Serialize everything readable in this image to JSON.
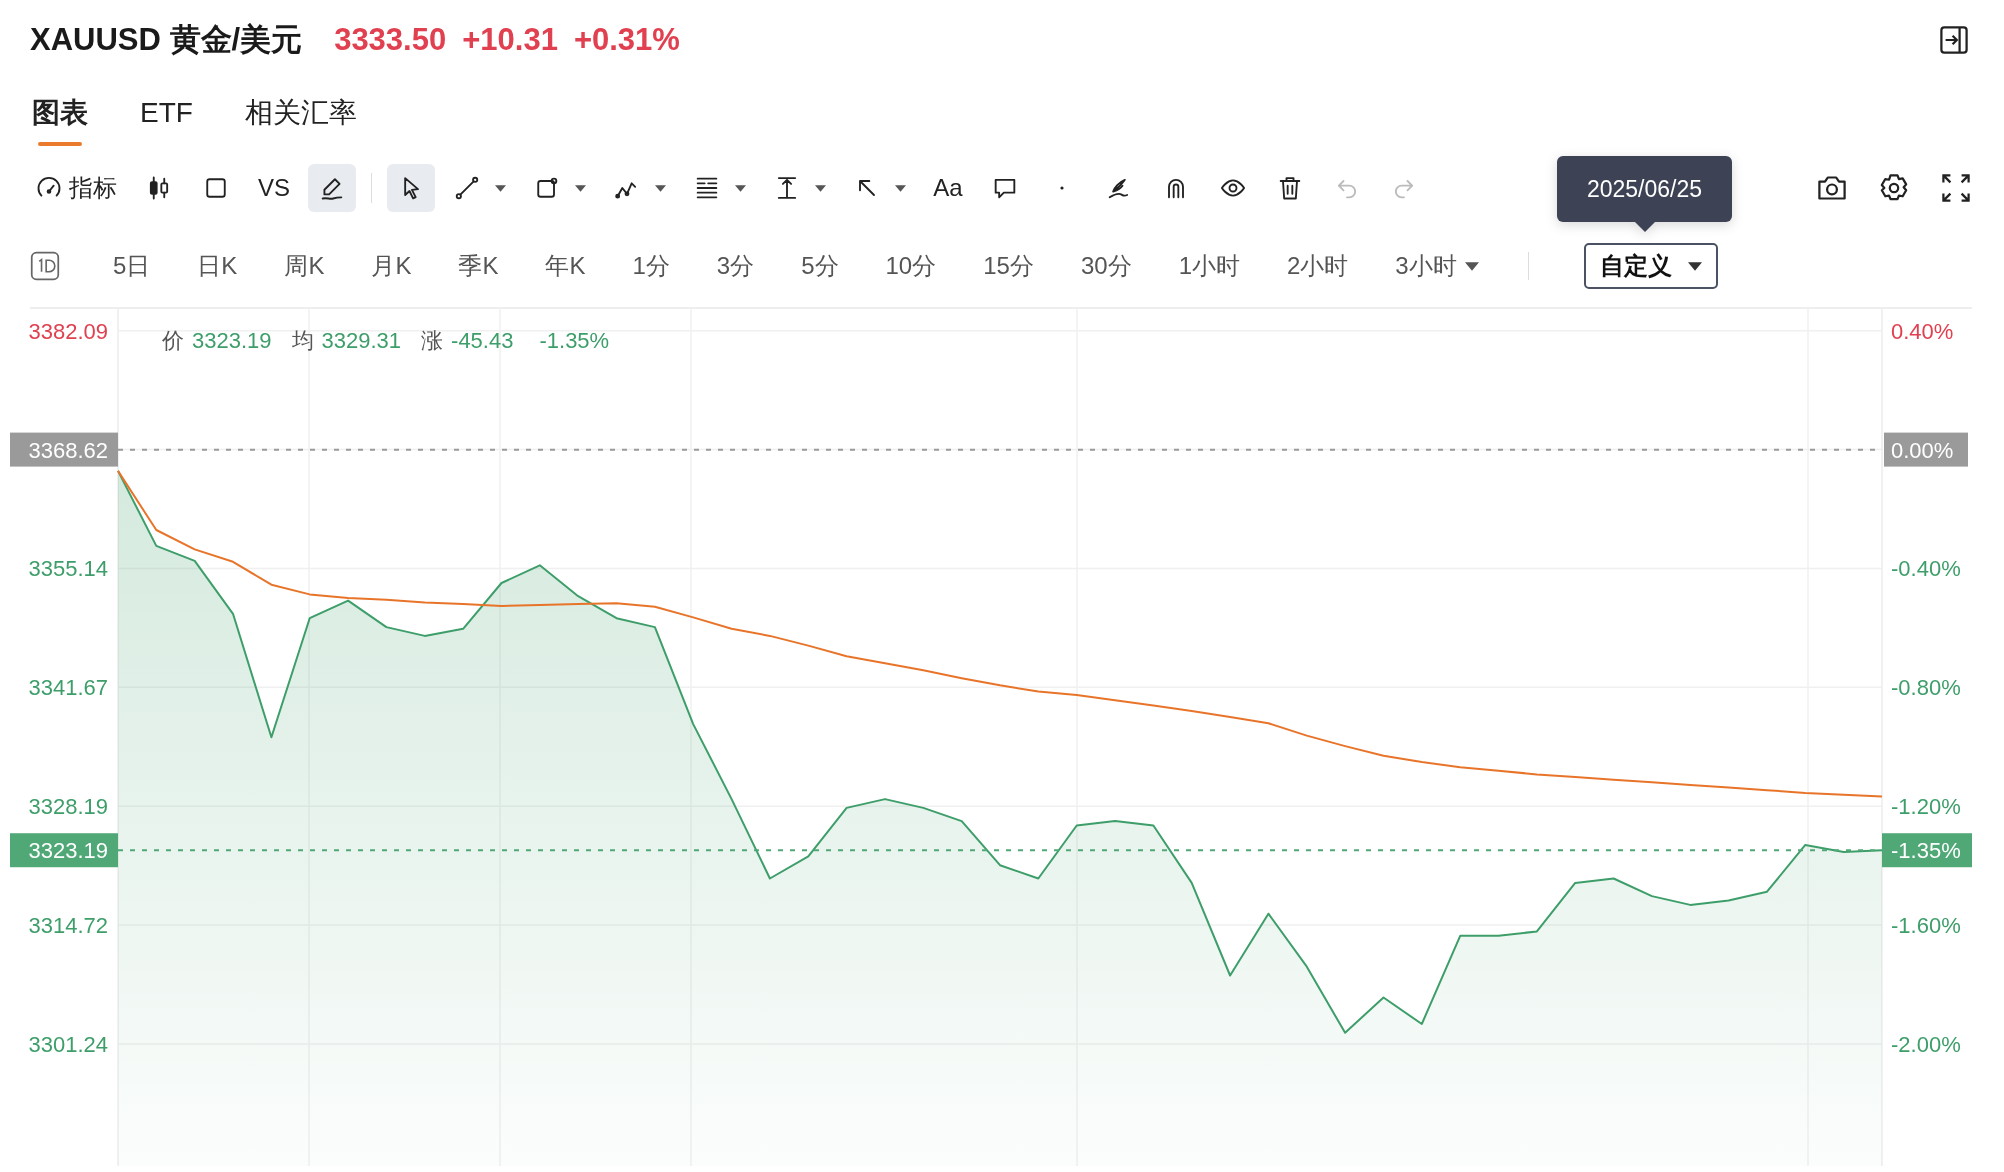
{
  "header": {
    "symbol": "XAUUSD 黄金/美元",
    "price": "3333.50",
    "change": "+10.31",
    "change_percent": "+0.31%"
  },
  "tabs": [
    {
      "label": "图表",
      "selected": true
    },
    {
      "label": "ETF",
      "selected": false
    },
    {
      "label": "相关汇率",
      "selected": false
    }
  ],
  "toolbar": {
    "tools": [
      {
        "kind": "icon-text",
        "label": "指标",
        "selected": false,
        "dropdown": false,
        "disabled": false
      },
      {
        "kind": "icon",
        "selected": false,
        "dropdown": false,
        "disabled": false
      },
      {
        "kind": "icon",
        "selected": false,
        "dropdown": false,
        "disabled": false
      },
      {
        "kind": "text",
        "label": "VS",
        "selected": false,
        "dropdown": false,
        "disabled": false
      },
      {
        "kind": "icon",
        "selected": true,
        "dropdown": false,
        "disabled": false
      },
      {
        "kind": "divider"
      },
      {
        "kind": "icon",
        "selected": true,
        "dropdown": false,
        "disabled": false
      },
      {
        "kind": "icon",
        "selected": false,
        "dropdown": true,
        "disabled": false
      },
      {
        "kind": "icon",
        "selected": false,
        "dropdown": true,
        "disabled": false
      },
      {
        "kind": "icon",
        "selected": false,
        "dropdown": true,
        "disabled": false
      },
      {
        "kind": "icon",
        "selected": false,
        "dropdown": true,
        "disabled": false
      },
      {
        "kind": "icon",
        "selected": false,
        "dropdown": true,
        "disabled": false
      },
      {
        "kind": "icon",
        "selected": false,
        "dropdown": true,
        "disabled": false
      },
      {
        "kind": "text",
        "label": "Aa",
        "selected": false,
        "dropdown": false,
        "disabled": false
      },
      {
        "kind": "icon",
        "selected": false,
        "dropdown": false,
        "disabled": false
      },
      {
        "kind": "icon",
        "selected": false,
        "dropdown": false,
        "disabled": false
      },
      {
        "kind": "icon",
        "selected": false,
        "dropdown": false,
        "disabled": false
      },
      {
        "kind": "icon",
        "selected": false,
        "dropdown": false,
        "disabled": false
      },
      {
        "kind": "icon",
        "selected": false,
        "dropdown": false,
        "disabled": false
      },
      {
        "kind": "icon",
        "selected": false,
        "dropdown": false,
        "disabled": false
      },
      {
        "kind": "icon",
        "selected": false,
        "dropdown": false,
        "disabled": true
      },
      {
        "kind": "icon",
        "selected": false,
        "dropdown": false,
        "disabled": true
      }
    ]
  },
  "intervals": [
    {
      "label": "5日",
      "selected": false,
      "dropdown": false
    },
    {
      "label": "日K",
      "selected": false,
      "dropdown": false
    },
    {
      "label": "周K",
      "selected": false,
      "dropdown": false
    },
    {
      "label": "月K",
      "selected": false,
      "dropdown": false
    },
    {
      "label": "季K",
      "selected": false,
      "dropdown": false
    },
    {
      "label": "年K",
      "selected": false,
      "dropdown": false
    },
    {
      "label": "1分",
      "selected": false,
      "dropdown": false
    },
    {
      "label": "3分",
      "selected": false,
      "dropdown": false
    },
    {
      "label": "5分",
      "selected": false,
      "dropdown": false
    },
    {
      "label": "10分",
      "selected": false,
      "dropdown": false
    },
    {
      "label": "15分",
      "selected": false,
      "dropdown": false
    },
    {
      "label": "30分",
      "selected": false,
      "dropdown": false
    },
    {
      "label": "1小时",
      "selected": false,
      "dropdown": false
    },
    {
      "label": "2小时",
      "selected": false,
      "dropdown": false
    },
    {
      "label": "3小时",
      "selected": false,
      "dropdown": true
    }
  ],
  "custom_range": {
    "label": "自定义",
    "selected": true,
    "dropdown": true,
    "tooltip": "2025/06/25"
  },
  "chart": {
    "legend": [
      {
        "label": "价",
        "value": "3323.19"
      },
      {
        "label": "均",
        "value": "3329.31"
      },
      {
        "label": "涨",
        "value": "-45.43"
      },
      {
        "value": "-1.35%"
      }
    ],
    "percent_axis": [
      {
        "label": "0.40%",
        "kind": "up"
      },
      {
        "label": "0.00%",
        "kind": "base"
      },
      {
        "label": "-0.40%",
        "kind": "down"
      },
      {
        "label": "-0.80%",
        "kind": "down"
      },
      {
        "label": "-1.20%",
        "kind": "down"
      },
      {
        "label": "-1.60%",
        "kind": "down"
      },
      {
        "label": "-2.00%",
        "kind": "down"
      }
    ],
    "current_price": "3323.19",
    "current_percent": "-1.35%",
    "chart_data": {
      "type": "area",
      "grid": true,
      "ylim": [
        3287.4,
        3384.9
      ],
      "yticks": [
        {
          "value": 3382.09,
          "label": "3382.09"
        },
        {
          "value": 3368.62,
          "label": "3368.62"
        },
        {
          "value": 3355.14,
          "label": "3355.14"
        },
        {
          "value": 3341.67,
          "label": "3341.67"
        },
        {
          "value": 3328.19,
          "label": "3328.19"
        },
        {
          "value": 3314.72,
          "label": "3314.72"
        },
        {
          "value": 3301.24,
          "label": "3301.24"
        }
      ],
      "series": [
        {
          "type": "area",
          "color": "#3e9e6a",
          "values": [
            3366.2,
            3357.7,
            3356.0,
            3350.0,
            3336.0,
            3349.5,
            3351.5,
            3348.5,
            3347.5,
            3348.3,
            3353.5,
            3355.5,
            3352.0,
            3349.5,
            3348.5,
            3337.5,
            3329.0,
            3320.0,
            3322.5,
            3328.0,
            3329.0,
            3328.0,
            3326.5,
            3321.5,
            3320.0,
            3326.0,
            3326.5,
            3326.0,
            3319.5,
            3309.0,
            3316.0,
            3310.0,
            3302.5,
            3306.5,
            3303.5,
            3313.5,
            3313.5,
            3314.0,
            3319.5,
            3320.0,
            3318.0,
            3317.0,
            3317.5,
            3318.5,
            3323.8,
            3323.0,
            3323.2
          ]
        },
        {
          "type": "line",
          "color": "#e8742a",
          "values": [
            3366.2,
            3359.5,
            3357.3,
            3355.9,
            3353.3,
            3352.2,
            3351.8,
            3351.6,
            3351.3,
            3351.1,
            3350.9,
            3351.0,
            3351.1,
            3351.2,
            3350.8,
            3349.6,
            3348.3,
            3347.5,
            3346.4,
            3345.2,
            3344.4,
            3343.6,
            3342.7,
            3341.9,
            3341.2,
            3340.8,
            3340.2,
            3339.6,
            3339.0,
            3338.3,
            3337.6,
            3336.2,
            3335.0,
            3333.9,
            3333.2,
            3332.6,
            3332.2,
            3331.8,
            3331.5,
            3331.2,
            3330.9,
            3330.6,
            3330.3,
            3330.0,
            3329.7,
            3329.5,
            3329.3
          ]
        },
        {
          "type": "line",
          "line_style": "dashed",
          "color": "#9a9a9a",
          "values": [
            3368.6,
            3368.6,
            3368.6,
            3368.6,
            3368.6,
            3368.6,
            3368.6,
            3368.6,
            3368.6,
            3368.6,
            3368.6,
            3368.6,
            3368.6,
            3368.6,
            3368.6,
            3368.6,
            3368.6,
            3368.6,
            3368.6,
            3368.6,
            3368.6,
            3368.6,
            3368.6,
            3368.6,
            3368.6,
            3368.6,
            3368.6,
            3368.6,
            3368.6,
            3368.6,
            3368.6,
            3368.6,
            3368.6,
            3368.6,
            3368.6,
            3368.6,
            3368.6,
            3368.6,
            3368.6,
            3368.6,
            3368.6,
            3368.6,
            3368.6,
            3368.6,
            3368.6,
            3368.6,
            3368.6
          ]
        },
        {
          "type": "line",
          "line_style": "dashed",
          "color": "#4fa876",
          "values": [
            3323.2,
            3323.2,
            3323.2,
            3323.2,
            3323.2,
            3323.2,
            3323.2,
            3323.2,
            3323.2,
            3323.2,
            3323.2,
            3323.2,
            3323.2,
            3323.2,
            3323.2,
            3323.2,
            3323.2,
            3323.2,
            3323.2,
            3323.2,
            3323.2,
            3323.2,
            3323.2,
            3323.2,
            3323.2,
            3323.2,
            3323.2,
            3323.2,
            3323.2,
            3323.2,
            3323.2,
            3323.2,
            3323.2,
            3323.2,
            3323.2,
            3323.2,
            3323.2,
            3323.2,
            3323.2,
            3323.2,
            3323.2,
            3323.2,
            3323.2,
            3323.2,
            3323.2,
            3323.2,
            3323.2
          ]
        }
      ]
    }
  }
}
